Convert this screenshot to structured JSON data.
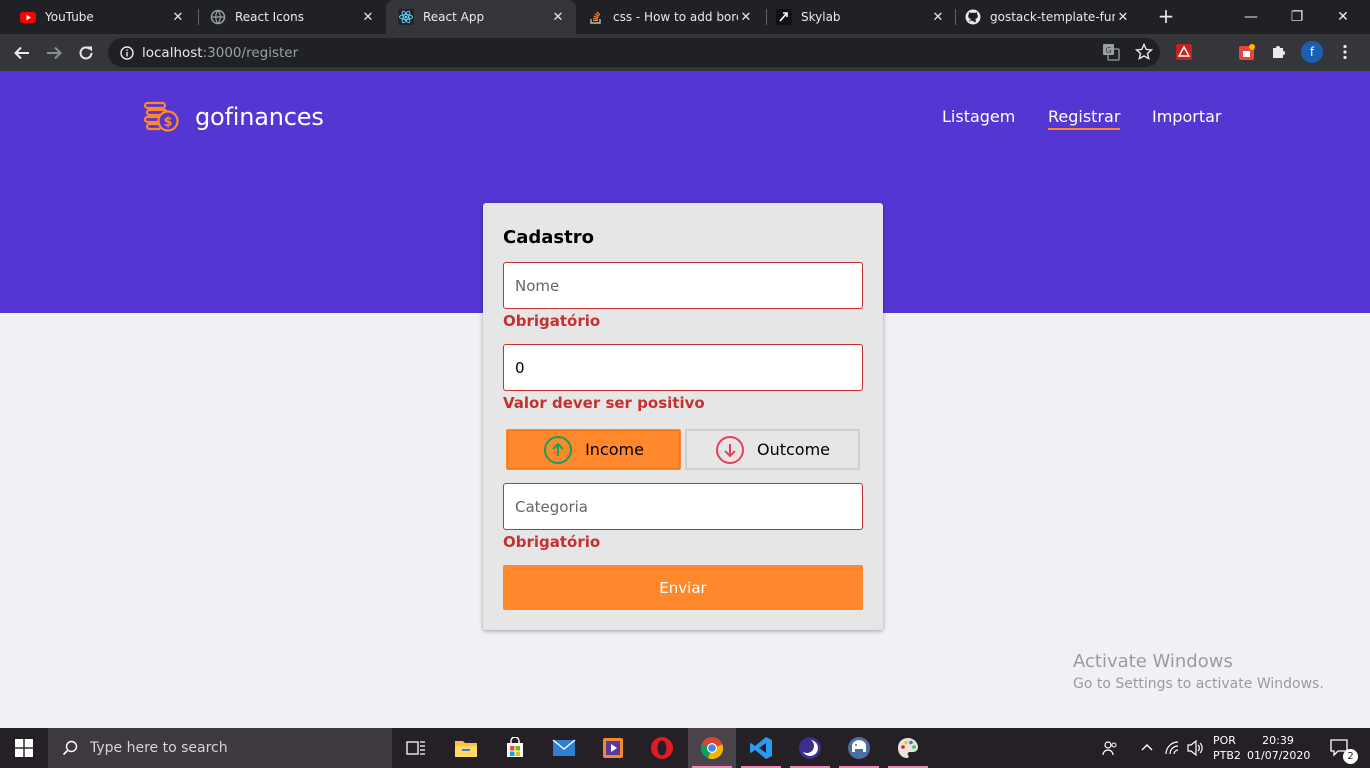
{
  "browser": {
    "tabs": [
      {
        "title": "YouTube",
        "favicon": "youtube-icon",
        "active": false
      },
      {
        "title": "React Icons",
        "favicon": "globe-icon",
        "active": false
      },
      {
        "title": "React App",
        "favicon": "react-icon",
        "active": true
      },
      {
        "title": "css - How to add borde",
        "favicon": "stackoverflow-icon",
        "active": false
      },
      {
        "title": "Skylab",
        "favicon": "skylab-icon",
        "active": false
      },
      {
        "title": "gostack-template-fund",
        "favicon": "github-icon",
        "active": false
      }
    ],
    "new_tab": "+",
    "window_controls": {
      "minimize": "—",
      "restore": "❐",
      "close": "✕"
    },
    "address": {
      "host": "localhost",
      "path": ":3000/register"
    },
    "profile_initial": "f"
  },
  "app": {
    "brand": "gofinances",
    "nav": [
      {
        "label": "Listagem",
        "active": false
      },
      {
        "label": "Registrar",
        "active": true
      },
      {
        "label": "Importar",
        "active": false
      }
    ],
    "colors": {
      "primary": "#5636d3",
      "accent": "#ff872c",
      "error": "#c53030",
      "income_icon": "#12a454",
      "outcome_icon": "#e83f5b"
    }
  },
  "form": {
    "title": "Cadastro",
    "name": {
      "placeholder": "Nome",
      "value": "",
      "error": "Obrigatório"
    },
    "amount": {
      "placeholder": "",
      "value": "0",
      "error": "Valor dever ser positivo"
    },
    "type": {
      "income_label": "Income",
      "outcome_label": "Outcome",
      "selected": "income"
    },
    "category": {
      "placeholder": "Categoria",
      "value": "",
      "error": "Obrigatório"
    },
    "submit_label": "Enviar"
  },
  "watermark": {
    "line1": "Activate Windows",
    "line2": "Go to Settings to activate Windows."
  },
  "taskbar": {
    "search_placeholder": "Type here to search",
    "apps": [
      "task-view-icon",
      "file-explorer-icon",
      "store-icon",
      "mail-icon",
      "media-player-icon",
      "opera-icon",
      "chrome-icon",
      "vscode-icon",
      "browser-moon-icon",
      "elephant-icon",
      "paint-icon"
    ],
    "language": {
      "line1": "POR",
      "line2": "PTB2"
    },
    "clock": {
      "time": "20:39",
      "date": "01/07/2020"
    },
    "notifications": "2"
  }
}
